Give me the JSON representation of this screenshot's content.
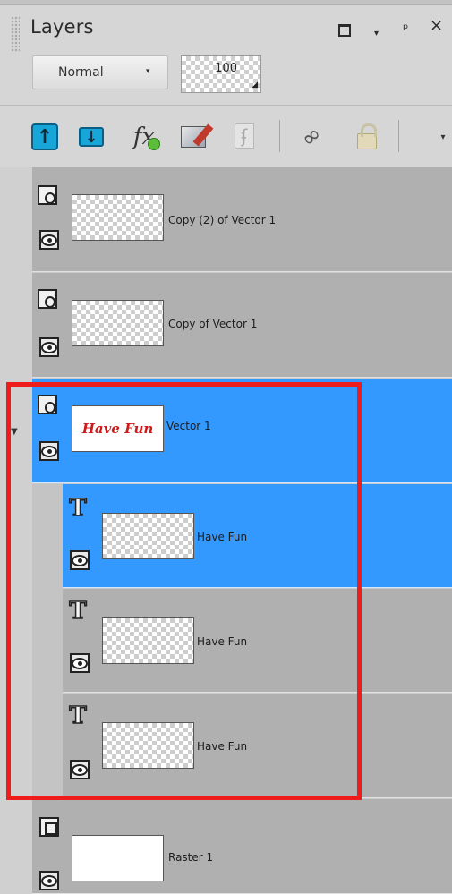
{
  "panel": {
    "title": "Layers",
    "blend_mode": "Normal",
    "opacity": "100"
  },
  "toolbar": {
    "icons": [
      "move-up-icon",
      "move-down-icon",
      "layer-effects-icon",
      "edit-layer-icon",
      "mask-icon",
      "link-icon",
      "lock-icon",
      "more-dropdown-icon"
    ]
  },
  "layers": [
    {
      "name": "Copy (2) of Vector 1",
      "type": "vector",
      "thumbnail": "transparent",
      "selected": false
    },
    {
      "name": "Copy of Vector 1",
      "type": "vector",
      "thumbnail": "transparent",
      "selected": false
    },
    {
      "name": "Vector 1",
      "type": "vector",
      "thumbnail": "text",
      "thumbnail_text": "Have Fun",
      "selected": true,
      "expanded": true
    },
    {
      "name": "Have Fun",
      "type": "text",
      "thumbnail": "transparent",
      "selected": true,
      "child": true
    },
    {
      "name": "Have Fun",
      "type": "text",
      "thumbnail": "transparent",
      "selected": false,
      "child": true
    },
    {
      "name": "Have Fun",
      "type": "text",
      "thumbnail": "transparent",
      "selected": false,
      "child": true
    },
    {
      "name": "Raster 1",
      "type": "raster",
      "thumbnail": "white",
      "selected": false
    }
  ],
  "colors": {
    "selection": "#3399ff",
    "highlight_box": "#ef1c1c",
    "toolbar_button": "#18a6d8"
  }
}
